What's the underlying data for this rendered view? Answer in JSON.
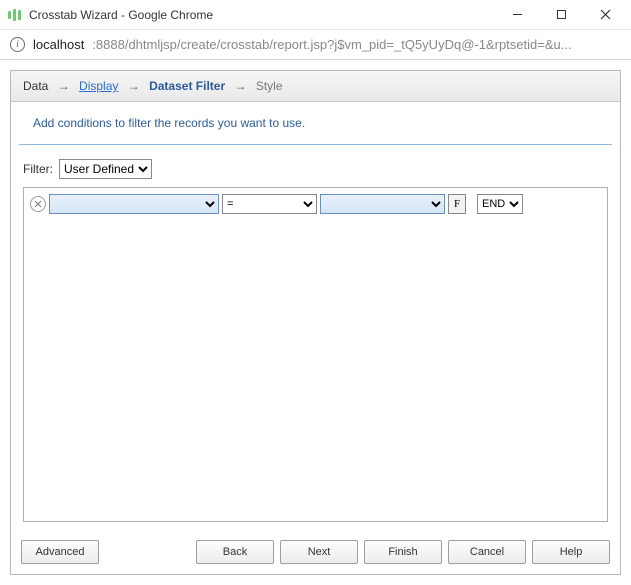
{
  "window": {
    "title": "Crosstab Wizard - Google Chrome"
  },
  "address": {
    "host": "localhost",
    "path": ":8888/dhtmljsp/create/crosstab/report.jsp?j$vm_pid=_tQ5yUyDq@-1&rptsetid=&u..."
  },
  "breadcrumb": {
    "step1": "Data",
    "step2": "Display",
    "step3": "Dataset Filter",
    "step4": "Style"
  },
  "instruction": "Add conditions to filter the records you want to use.",
  "filter": {
    "label": "Filter:",
    "selected": "User Defined"
  },
  "condition": {
    "field": "",
    "operator": "=",
    "value": "",
    "f_label": "F",
    "end": "END"
  },
  "buttons": {
    "advanced": "Advanced",
    "back": "Back",
    "next": "Next",
    "finish": "Finish",
    "cancel": "Cancel",
    "help": "Help"
  }
}
